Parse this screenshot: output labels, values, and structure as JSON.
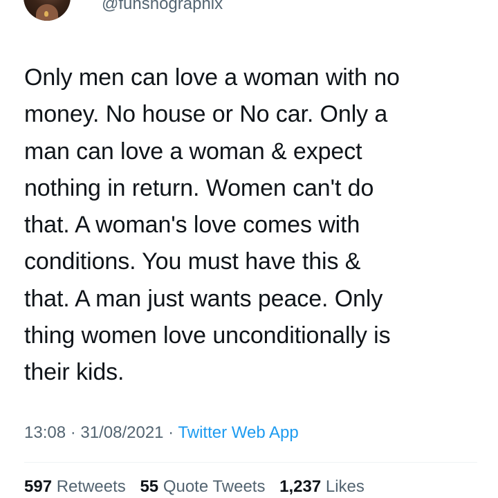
{
  "user": {
    "handle": "@funshographix"
  },
  "tweet": {
    "text": "Only men can love a woman with no\nmoney. No house or No car. Only a\nman can love a woman & expect\nnothing in return. Women can't do\nthat. A woman's love comes with\nconditions. You must have this &\nthat. A man just wants peace. Only\nthing women love unconditionally is\ntheir kids.",
    "time": "13:08",
    "date": "31/08/2021",
    "source": "Twitter Web App",
    "separator": " · "
  },
  "stats": {
    "retweets_count": "597",
    "retweets_label": "Retweets",
    "quotes_count": "55",
    "quotes_label": "Quote Tweets",
    "likes_count": "1,237",
    "likes_label": "Likes"
  },
  "colors": {
    "text": "#0f1419",
    "secondary": "#536471",
    "link": "#1d9bf0"
  }
}
